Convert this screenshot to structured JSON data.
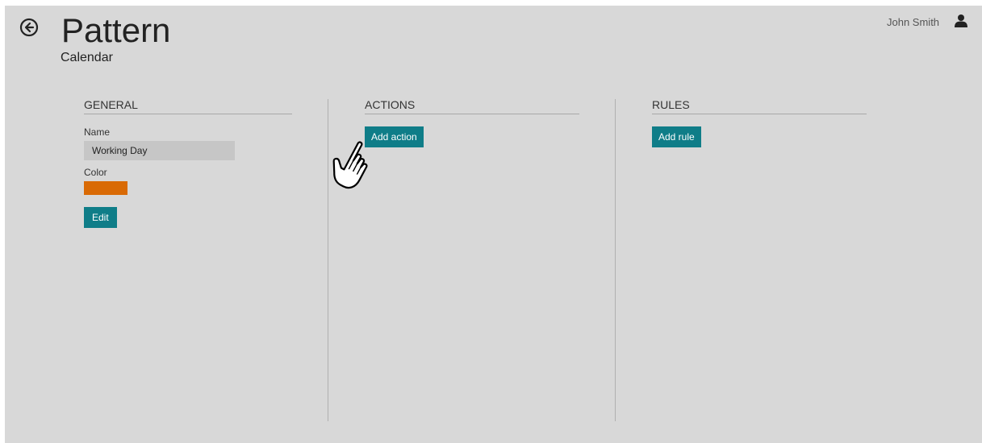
{
  "header": {
    "title": "Pattern",
    "subtitle": "Calendar",
    "back_icon": "back-arrow-circle-icon"
  },
  "user": {
    "name": "John Smith",
    "icon": "user-icon"
  },
  "general": {
    "title": "GENERAL",
    "name_label": "Name",
    "name_value": "Working Day",
    "color_label": "Color",
    "color_value": "#d96a05",
    "edit_label": "Edit"
  },
  "actions": {
    "title": "ACTIONS",
    "add_label": "Add action"
  },
  "rules": {
    "title": "RULES",
    "add_label": "Add rule"
  },
  "colors": {
    "background": "#d8d8d8",
    "accent": "#0f7d88",
    "swatch": "#d96a05"
  },
  "cursor": "hand-pointer-icon"
}
